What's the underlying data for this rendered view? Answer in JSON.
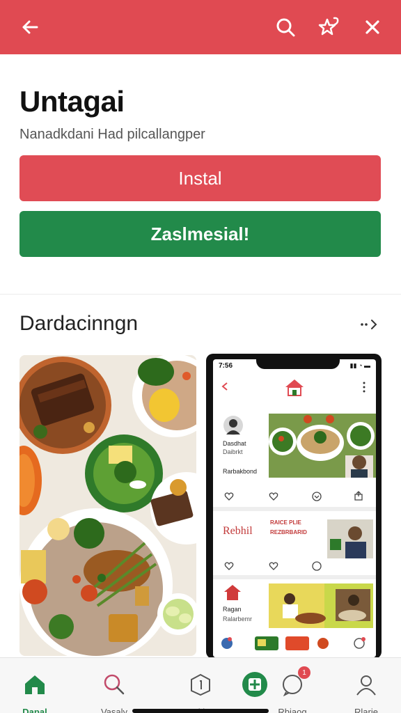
{
  "header": {
    "back_icon": "arrow-left-icon",
    "search_icon": "search-icon",
    "wishlist_icon": "star-plus-icon",
    "close_icon": "close-icon",
    "color": "#e04a52"
  },
  "app": {
    "title": "Untagai",
    "subtitle": "Nanadkdani Had pilcallangper",
    "install_label": "Instal",
    "secondary_label": "Zaslmesial!"
  },
  "section": {
    "title": "Dardacinngn",
    "more_icon": "chevron-right-icon"
  },
  "screenshots": {
    "phone": {
      "status_time": "7:56",
      "row1_name": "Dasdhat",
      "row1_line2": "Daibrkt",
      "row2_label": "Rarbakbond",
      "row3_title": "Rebhil",
      "row3_text": "RAICE PLIE",
      "row3_text2": "REZBRBARID",
      "row4_title": "Ragan",
      "row4_line": "Ralarbemr"
    }
  },
  "bottom_nav": {
    "items": [
      {
        "label": "Dapal",
        "icon": "home-icon",
        "active": true
      },
      {
        "label": "Vasaly",
        "icon": "search-icon",
        "active": false
      },
      {
        "label": "Hkly",
        "icon": "cube-icon",
        "active": false
      },
      {
        "label": "",
        "icon": "grid-add-icon",
        "active": false
      },
      {
        "label": "Rbiaog",
        "icon": "chat-icon",
        "active": false,
        "badge": "1"
      },
      {
        "label": "Rlarie",
        "icon": "user-icon",
        "active": false
      }
    ]
  },
  "colors": {
    "primary_red": "#e04c55",
    "primary_green": "#228a4a"
  }
}
